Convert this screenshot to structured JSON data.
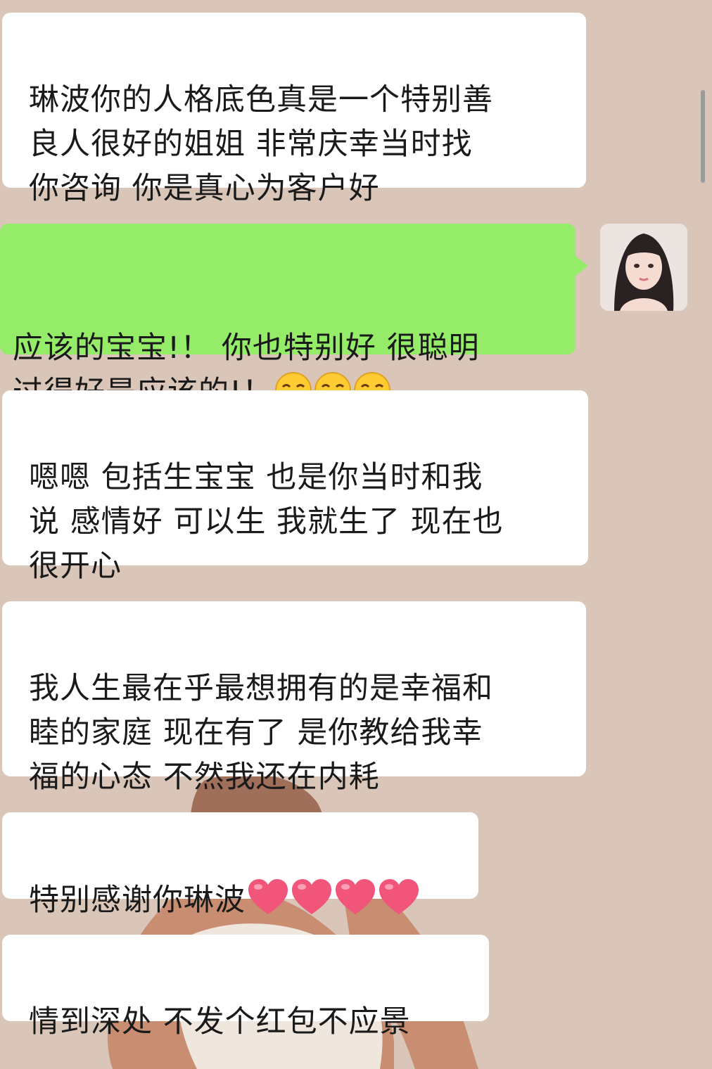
{
  "chat": {
    "messages": [
      {
        "side": "incoming",
        "text": "琳波你的人格底色真是一个特别善\n良人很好的姐姐 非常庆幸当时找\n你咨询 你是真心为客户好"
      },
      {
        "side": "outgoing",
        "text": "应该的宝宝!！ 你也特别好 很聪明\n过得好是应该的!！",
        "emoji": "kissing-face-emoji",
        "emoji_count": 3
      },
      {
        "side": "incoming",
        "text": "嗯嗯 包括生宝宝 也是你当时和我\n说 感情好 可以生 我就生了 现在也\n很开心"
      },
      {
        "side": "incoming",
        "text": "我人生最在乎最想拥有的是幸福和\n睦的家庭 现在有了 是你教给我幸\n福的心态 不然我还在内耗"
      },
      {
        "side": "incoming",
        "text": "特别感谢你琳波",
        "emoji": "heart-emoji",
        "emoji_count": 4
      },
      {
        "side": "incoming",
        "text": "情到深处 不发个红包不应景"
      }
    ]
  },
  "colors": {
    "chat_background": "#d9c6b8",
    "incoming_bubble": "#ffffff",
    "outgoing_bubble": "#95ec69"
  }
}
